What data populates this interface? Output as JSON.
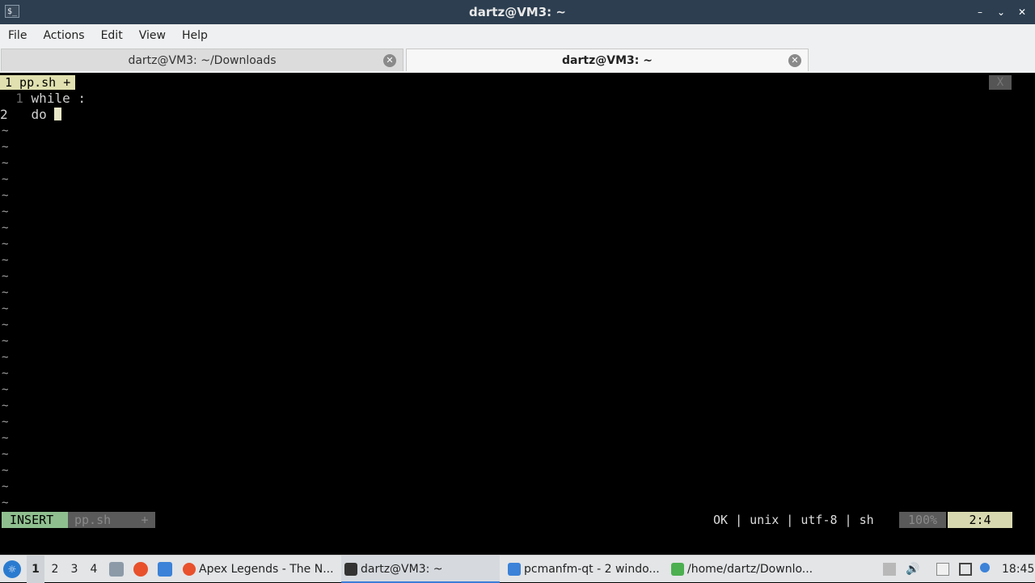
{
  "window": {
    "title": "dartz@VM3: ~",
    "app_icon_glyph": "$_",
    "controls": [
      "–",
      "⌄",
      "✕"
    ]
  },
  "menu": [
    "File",
    "Actions",
    "Edit",
    "View",
    "Help"
  ],
  "tabs": [
    {
      "label": "dartz@VM3: ~/Downloads",
      "active": false
    },
    {
      "label": "dartz@VM3: ~",
      "active": true
    }
  ],
  "vim": {
    "tabline": "1 pp.sh +",
    "tab_close": "X",
    "lines": [
      {
        "num": "1",
        "text": "while :"
      },
      {
        "num": "2",
        "text": "do"
      }
    ],
    "tilde": "~",
    "tilde_count": 24,
    "status": {
      "mode": "INSERT",
      "file": "pp.sh",
      "modified": "+",
      "info": "OK | unix | utf-8 | sh",
      "percent": "100%",
      "position": "2:4"
    }
  },
  "taskbar": {
    "workspaces": [
      "1",
      "2",
      "3",
      "4"
    ],
    "active_workspace": "1",
    "tasks": [
      {
        "label": "Apex Legends - The N...",
        "icon": "firefox-icon",
        "color": "#e8512b"
      },
      {
        "label": "dartz@VM3: ~",
        "icon": "terminal-icon",
        "color": "#333333",
        "active": true
      },
      {
        "label": "pcmanfm-qt - 2 windo...",
        "icon": "folder-icon",
        "color": "#3b82d8"
      },
      {
        "label": "/home/dartz/Downlo...",
        "icon": "text-editor-icon",
        "color": "#4caf50"
      }
    ],
    "clock": "18:45"
  },
  "colors": {
    "titlebar": "#2c3e50",
    "terminal_bg": "#000000",
    "insert_mode": "#8fbf8f",
    "vim_tab": "#e0e0b0"
  }
}
